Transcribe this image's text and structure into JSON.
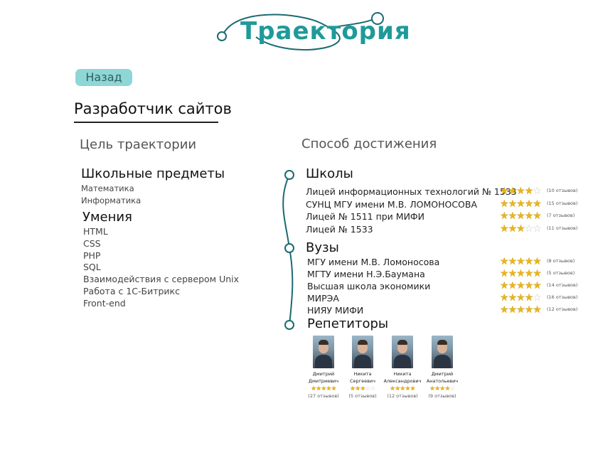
{
  "logo": {
    "text": "Траектория",
    "color": "#1f9a9a",
    "line_color": "#1b6a73"
  },
  "nav": {
    "back_label": "Назад"
  },
  "page": {
    "title": "Разработчик сайтов"
  },
  "goal": {
    "heading": "Цель траектории",
    "subjects_title": "Школьные предметы",
    "subjects": [
      "Математика",
      "Информатика"
    ],
    "skills_title": "Умения",
    "skills": [
      "HTML",
      "CSS",
      "PHP",
      "SQL",
      "Взаимодействия с сервером Unix",
      "Работа с  1С-Битрикс",
      "Front-end"
    ]
  },
  "method": {
    "heading": "Способ достижения",
    "schools": {
      "title": "Школы",
      "items": [
        {
          "name": "Лицей информационных технологий № 1533",
          "rating": 4,
          "reviews": "(10 отзывов)"
        },
        {
          "name": "СУНЦ МГУ имени М.В. ЛОМОНОСОВА",
          "rating": 5,
          "reviews": "(15 отзывов)"
        },
        {
          "name": "Лицей № 1511 при МИФИ",
          "rating": 5,
          "reviews": "(7 отзывов)"
        },
        {
          "name": "Лицей № 1533",
          "rating": 3,
          "reviews": "(11 отзывов)"
        }
      ]
    },
    "universities": {
      "title": "Вузы",
      "items": [
        {
          "name": "МГУ имени М.В. Ломоносова",
          "rating": 5,
          "reviews": "(8 отзывов)"
        },
        {
          "name": "МГТУ имени Н.Э.Баумана",
          "rating": 5,
          "reviews": "(5 отзывов)"
        },
        {
          "name": "Высшая школа экономики",
          "rating": 5,
          "reviews": "(14 отзывов)"
        },
        {
          "name": "МИРЭА",
          "rating": 4,
          "reviews": "(16 отзывов)"
        },
        {
          "name": "НИЯУ МИФИ",
          "rating": 5,
          "reviews": "(12 отзывов)"
        }
      ]
    },
    "tutors": {
      "title": "Репетиторы",
      "items": [
        {
          "first": "Дмитрий",
          "second": "Дмитриевич",
          "rating": 5,
          "reviews": "(27 отзывов)"
        },
        {
          "first": "Никита",
          "second": "Сергеевич",
          "rating": 3,
          "reviews": "(5 отзывов)"
        },
        {
          "first": "Никита",
          "second": "Александрович",
          "rating": 5,
          "reviews": "(12 отзывов)"
        },
        {
          "first": "Дмитрий",
          "second": "Анатольевич",
          "rating": 4,
          "reviews": "(9 отзывов)"
        }
      ]
    }
  },
  "colors": {
    "accent": "#8fd6d6",
    "timeline": "#1b6a73",
    "star": "#e8b51c"
  }
}
